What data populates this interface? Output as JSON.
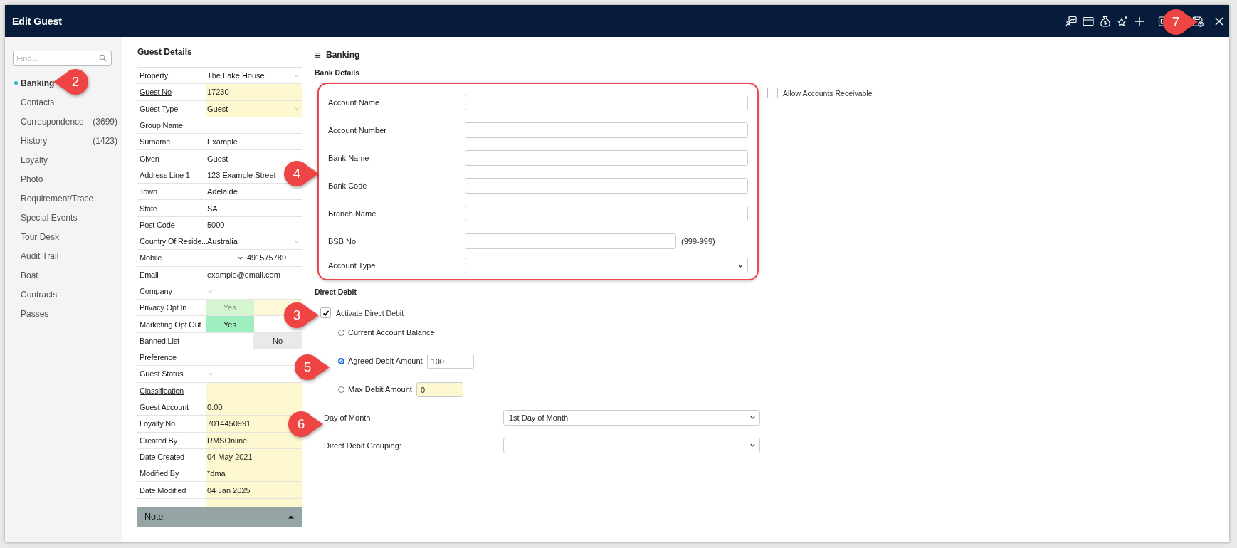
{
  "window": {
    "title": "Edit Guest"
  },
  "toolbar": {
    "icons": [
      {
        "kind": "chart-person"
      },
      {
        "kind": "card"
      },
      {
        "kind": "money-bag"
      },
      {
        "kind": "star"
      },
      {
        "kind": "plus"
      },
      {
        "kind": "frame"
      },
      {
        "kind": "save"
      },
      {
        "kind": "close"
      }
    ]
  },
  "sidebar": {
    "search": {
      "placeholder": "Find..."
    },
    "items": [
      {
        "label": "Banking",
        "selected": true
      },
      {
        "label": "Contacts",
        "selected": false
      },
      {
        "label": "Correspondence",
        "count": "(3699)",
        "selected": false
      },
      {
        "label": "History",
        "count": "(1423)",
        "selected": false
      },
      {
        "label": "Loyalty",
        "selected": false
      },
      {
        "label": "Photo",
        "selected": false
      },
      {
        "label": "Requirement/Trace",
        "selected": false
      },
      {
        "label": "Special Events",
        "selected": false
      },
      {
        "label": "Tour Desk",
        "selected": false
      },
      {
        "label": "Audit Trail",
        "selected": false
      },
      {
        "label": "Boat",
        "selected": false
      },
      {
        "label": "Contracts",
        "selected": false
      },
      {
        "label": "Passes",
        "selected": false
      }
    ]
  },
  "guest_details": {
    "title": "Guest Details",
    "rows": [
      {
        "kind": "text",
        "label": "Property",
        "value": "The Lake House",
        "dropdown": true
      },
      {
        "kind": "text",
        "label": "Guest No",
        "link": true,
        "value": "17230",
        "highlight": true
      },
      {
        "kind": "text",
        "label": "Guest Type",
        "value": "Guest",
        "highlight": true,
        "dropdown": true
      },
      {
        "kind": "text",
        "label": "Group Name"
      },
      {
        "kind": "text",
        "label": "Surname",
        "value": "Example"
      },
      {
        "kind": "text",
        "label": "Given",
        "value": "Guest"
      },
      {
        "kind": "text",
        "label": "Address Line 1",
        "value": "123 Example Street"
      },
      {
        "kind": "text",
        "label": "Town",
        "value": "Adelaide"
      },
      {
        "kind": "text",
        "label": "State",
        "value": "SA"
      },
      {
        "kind": "text",
        "label": "Post Code",
        "value": "5000"
      },
      {
        "kind": "text",
        "label": "Country Of Reside...",
        "value": "Australia",
        "dropdown": true
      },
      {
        "kind": "phone",
        "label": "Mobile",
        "value": "491575789"
      },
      {
        "kind": "text",
        "label": "Email",
        "value": "example@email.com"
      },
      {
        "kind": "text",
        "label": "Company",
        "link": true,
        "dropdown": true
      },
      {
        "kind": "toggle",
        "label": "Privacy Opt In",
        "cells": [
          {
            "text": "Yes",
            "color": "#d4f5d0",
            "muted": true
          },
          {
            "color": "#fdf8d8"
          }
        ]
      },
      {
        "kind": "toggle",
        "label": "Marketing Opt Out",
        "cells": [
          {
            "text": "Yes",
            "color": "#9eeec0",
            "muted": false
          }
        ]
      },
      {
        "kind": "toggle",
        "label": "Banned List",
        "cells": [
          {
            "text": "No",
            "color": "#e9e9e9",
            "muted": false,
            "shifted": true
          }
        ]
      },
      {
        "kind": "text",
        "label": "Preference"
      },
      {
        "kind": "text",
        "label": "Guest Status",
        "dropdown": true
      },
      {
        "kind": "text",
        "label": "Classification",
        "link": true,
        "highlight": true
      },
      {
        "kind": "text",
        "label": "Guest Account",
        "link": true,
        "value": "0.00",
        "highlight": true
      },
      {
        "kind": "text",
        "label": "Loyalty No",
        "value": "7014450991",
        "highlight": true
      },
      {
        "kind": "text",
        "label": "Created By",
        "value": "RMSOnline",
        "highlight": true
      },
      {
        "kind": "text",
        "label": "Date Created",
        "value": "04 May 2021",
        "highlight": true
      },
      {
        "kind": "text",
        "label": "Modified By",
        "value": "*dma",
        "highlight": true
      },
      {
        "kind": "text",
        "label": "Date Modified",
        "value": "04 Jan 2025",
        "highlight": true
      }
    ],
    "note": {
      "label": "Note",
      "expanded": true
    }
  },
  "banking": {
    "title": "Banking",
    "bank_details": {
      "title": "Bank Details",
      "fields": [
        {
          "kind": "input",
          "label": "Account Name"
        },
        {
          "kind": "input",
          "label": "Account Number"
        },
        {
          "kind": "input",
          "label": "Bank Name"
        },
        {
          "kind": "input",
          "label": "Bank Code"
        },
        {
          "kind": "input",
          "label": "Branch Name"
        },
        {
          "kind": "short-input",
          "label": "BSB No",
          "hint": "(999-999)"
        },
        {
          "kind": "select",
          "label": "Account Type"
        }
      ]
    },
    "allow_accounts_receivable": {
      "label": "Allow Accounts Receivable",
      "checked": false
    },
    "direct_debit": {
      "title": "Direct Debit",
      "activate": {
        "label": "Activate Direct Debit",
        "checked": true
      },
      "options": [
        {
          "label": "Current Account Balance",
          "selected": false
        },
        {
          "label": "Agreed Debit Amount",
          "selected": true,
          "value": "100",
          "highlight": false
        },
        {
          "label": "Max Debit Amount",
          "selected": false,
          "value": "0",
          "highlight": true
        }
      ],
      "selects": [
        {
          "label": "Day of Month",
          "value": "1st Day of Month"
        },
        {
          "label": "Direct Debit Grouping:"
        }
      ]
    }
  },
  "callouts": [
    {
      "label": "2",
      "kind": "pointer-left"
    },
    {
      "label": "4",
      "kind": "pointer-right"
    },
    {
      "label": "3",
      "kind": "pointer-right"
    },
    {
      "label": "5",
      "kind": "pointer-right"
    },
    {
      "label": "6",
      "kind": "pointer-right"
    },
    {
      "label": "7",
      "kind": "pointer-right"
    }
  ]
}
